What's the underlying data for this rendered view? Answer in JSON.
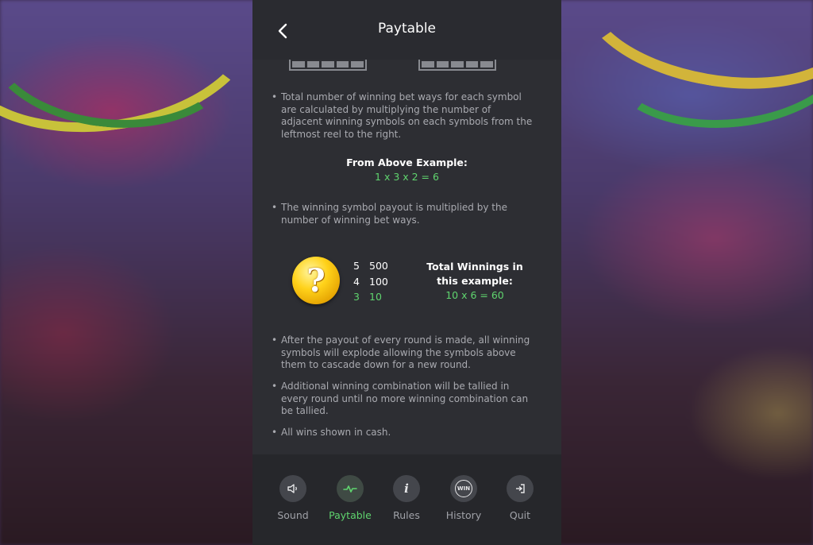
{
  "header": {
    "title": "Paytable",
    "back_icon": "chevron-left-icon"
  },
  "content": {
    "bullets_top": [
      "Total number of winning bet ways for each symbol are calculated by multiplying the number of adjacent winning symbols on each symbols from the leftmost reel to the right.",
      "The winning symbol payout is multiplied by the number of winning bet ways."
    ],
    "example": {
      "title": "From Above Example:",
      "formula": "1 x 3 x 2 = 6"
    },
    "symbol": {
      "glyph": "?",
      "icon": "question-mark-coin-icon",
      "payouts": [
        {
          "count": "5",
          "value": "500"
        },
        {
          "count": "4",
          "value": "100"
        },
        {
          "count": "3",
          "value": "10"
        }
      ]
    },
    "totals": {
      "title": "Total Winnings in this example:",
      "formula": "10 x 6 = 60"
    },
    "bullets_bottom": [
      "After the payout of every round is made, all winning symbols will explode allowing the symbols above them to cascade down for a new round.",
      "Additional winning combination will be tallied in every round until no more winning combination can be tallied.",
      "All wins shown in cash."
    ]
  },
  "nav": {
    "items": [
      {
        "label": "Sound",
        "icon": "speaker-icon"
      },
      {
        "label": "Paytable",
        "icon": "pulse-icon"
      },
      {
        "label": "Rules",
        "icon": "info-icon"
      },
      {
        "label": "History",
        "icon": "win-history-icon",
        "icon_text": "WIN"
      },
      {
        "label": "Quit",
        "icon": "exit-icon"
      }
    ],
    "active": "Paytable"
  },
  "colors": {
    "panel": "#2d2e33",
    "accent_green": "#5fd46e",
    "text": "#b9bac0"
  }
}
